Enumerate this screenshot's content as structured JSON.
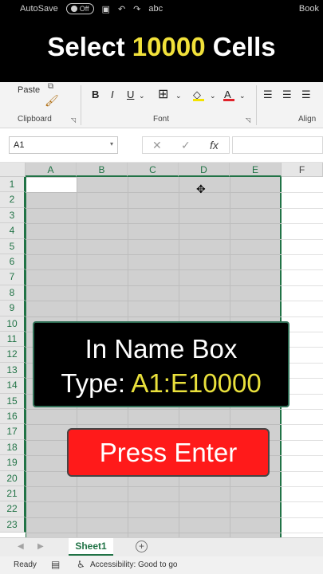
{
  "qat": {
    "autosave": "AutoSave",
    "toggle": "Off",
    "abc": "abc",
    "book": "Book"
  },
  "headline": {
    "pre": "Select ",
    "number": "10000",
    "post": " Cells"
  },
  "ribbon": {
    "paste": "Paste",
    "clipboard": "Clipboard",
    "font_group": "Font",
    "align": "Align",
    "bold": "B",
    "italic": "I",
    "underline": "U",
    "font_color_letter": "A"
  },
  "formula_bar": {
    "name_box": "A1",
    "cancel": "✕",
    "enter": "✓",
    "fx": "fx"
  },
  "columns": [
    "A",
    "B",
    "C",
    "D",
    "E",
    "F"
  ],
  "rows": [
    "1",
    "2",
    "3",
    "4",
    "5",
    "6",
    "7",
    "8",
    "9",
    "10",
    "11",
    "12",
    "13",
    "14",
    "15",
    "16",
    "17",
    "18",
    "19",
    "20",
    "21",
    "22",
    "23"
  ],
  "banner": {
    "line1": "In Name Box",
    "line2_pre": "Type: ",
    "line2_range": "A1:E10000"
  },
  "button": {
    "label": "Press Enter"
  },
  "sheet_tabs": {
    "active": "Sheet1",
    "add": "+"
  },
  "status": {
    "ready": "Ready",
    "accessibility": "Accessibility: Good to go"
  },
  "colors": {
    "excel_green": "#217346",
    "highlight": "#f1e13a",
    "button_red": "#ff1a1a"
  },
  "icons": [
    "autosave-toggle-icon",
    "save-icon",
    "undo-icon",
    "redo-icon",
    "spellcheck-icon",
    "paste-icon",
    "format-painter-icon",
    "borders-icon",
    "fill-color-icon",
    "font-color-icon",
    "align-left-icon",
    "align-center-icon",
    "align-right-icon",
    "crosshair-cursor-icon",
    "macro-icon",
    "accessibility-icon"
  ]
}
